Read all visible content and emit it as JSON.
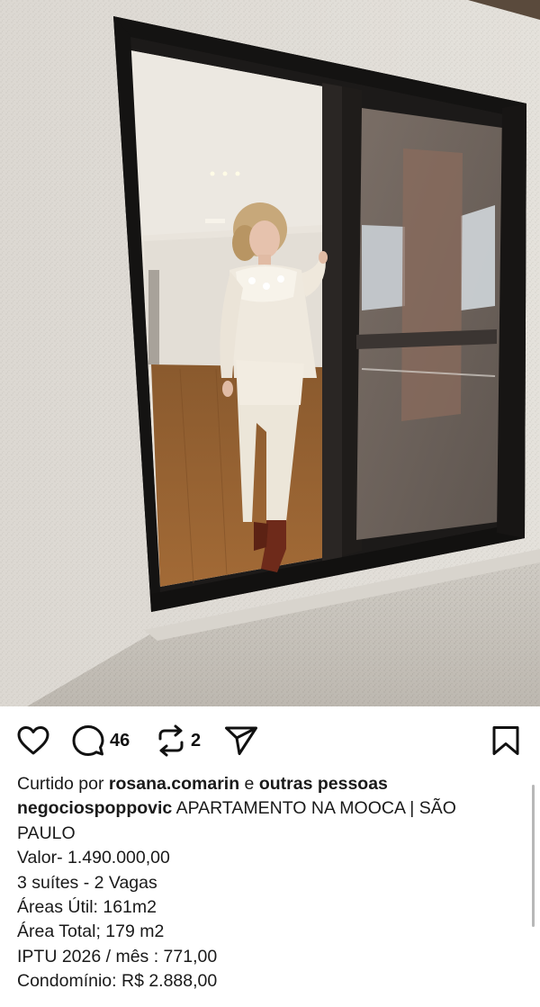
{
  "actions": {
    "comments_count": "46",
    "reposts_count": "2"
  },
  "liked_by": {
    "prefix": "Curtido por",
    "user": "rosana.comarin",
    "joiner": "e",
    "others": "outras pessoas"
  },
  "caption": {
    "author": "negociospoppovic",
    "headline": "APARTAMENTO NA MOOCA | SÃO PAULO",
    "lines": [
      "Valor- 1.490.000,00",
      "3 suítes - 2 Vagas",
      "Áreas Útil: 161m2",
      "Área Total; 179 m2",
      "IPTU 2026 / mês : 771,00",
      "Condomínio: R$ 2.888,00"
    ]
  },
  "icons": {
    "like": "heart-icon",
    "comment": "comment-bubble-icon",
    "repost": "repost-icon",
    "share": "send-icon",
    "save": "bookmark-icon"
  }
}
